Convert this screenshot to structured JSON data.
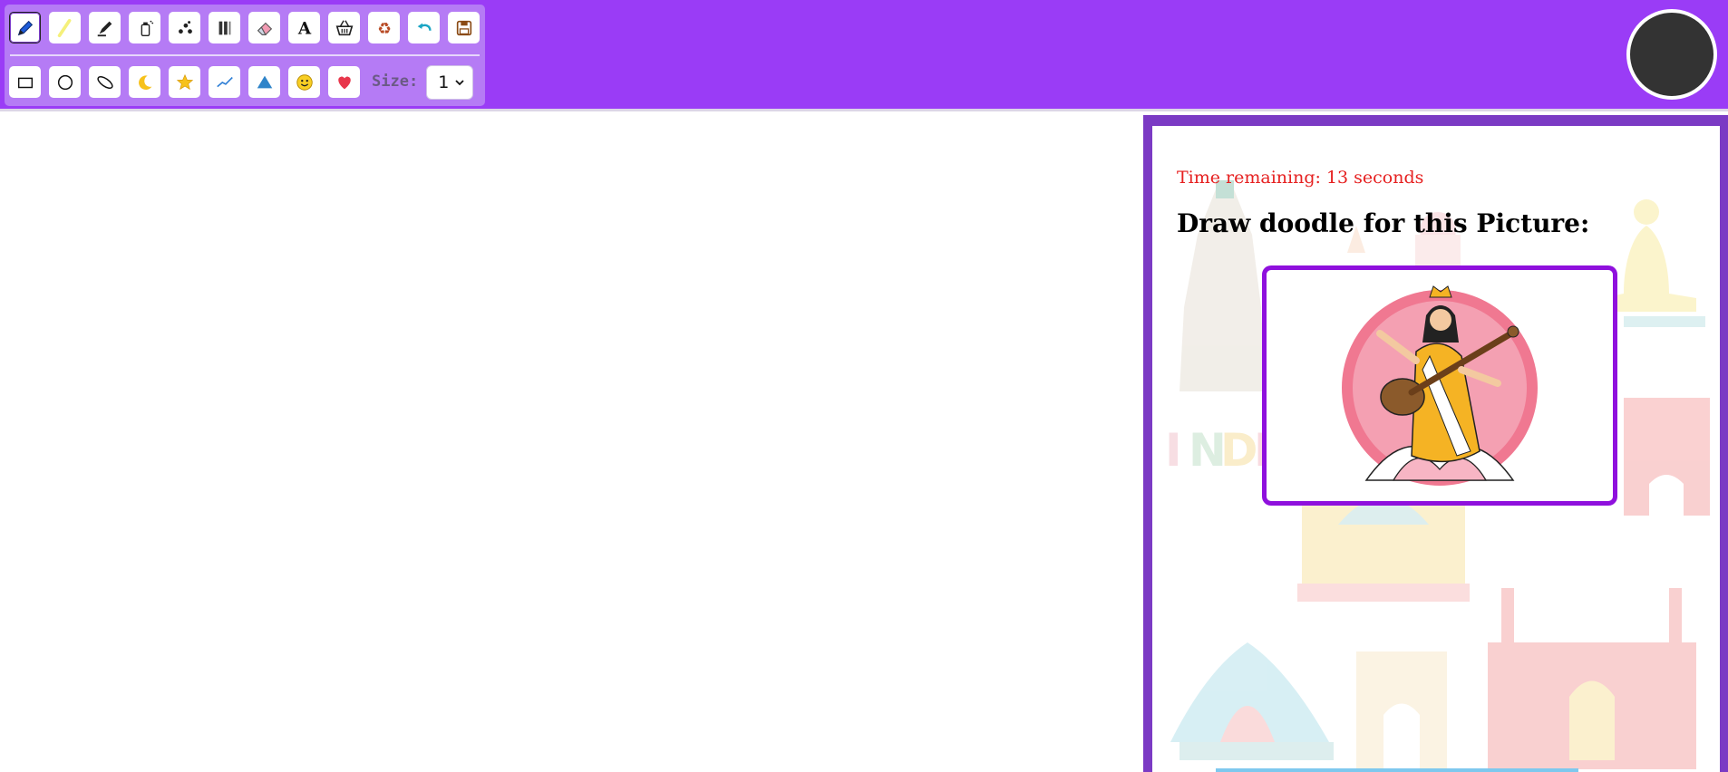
{
  "toolbar": {
    "row1_tools": [
      {
        "name": "pen-tool-button",
        "icon": "pen-icon"
      },
      {
        "name": "highlighter-tool-button",
        "icon": "highlighter-icon"
      },
      {
        "name": "marker-tool-button",
        "icon": "marker-icon"
      },
      {
        "name": "spray-tool-button",
        "icon": "spray-can-icon"
      },
      {
        "name": "dots-tool-button",
        "icon": "dots-icon"
      },
      {
        "name": "pattern-brush-button",
        "icon": "pattern-brush-icon"
      },
      {
        "name": "eraser-tool-button",
        "icon": "eraser-icon"
      },
      {
        "name": "text-tool-button",
        "icon": "text-a-icon"
      },
      {
        "name": "fill-bucket-button",
        "icon": "basket-icon"
      },
      {
        "name": "clear-recycle-button",
        "icon": "recycle-icon"
      },
      {
        "name": "undo-button",
        "icon": "undo-arrow-icon"
      },
      {
        "name": "save-button",
        "icon": "floppy-disk-icon"
      }
    ],
    "row2_tools": [
      {
        "name": "rectangle-shape-button",
        "icon": "rectangle-icon"
      },
      {
        "name": "circle-shape-button",
        "icon": "circle-icon"
      },
      {
        "name": "ellipse-shape-button",
        "icon": "ellipse-icon"
      },
      {
        "name": "moon-shape-button",
        "icon": "crescent-moon-icon"
      },
      {
        "name": "star-shape-button",
        "icon": "star-icon"
      },
      {
        "name": "line-shape-button",
        "icon": "line-icon"
      },
      {
        "name": "triangle-shape-button",
        "icon": "triangle-icon"
      },
      {
        "name": "smiley-shape-button",
        "icon": "smiley-icon"
      },
      {
        "name": "heart-shape-button",
        "icon": "heart-icon"
      }
    ],
    "size_label": "Size:",
    "size_value": "1",
    "active_tool": "pen-tool-button"
  },
  "colors": {
    "header": "#9a3cf6",
    "toolbox": "#b57bf5",
    "panel_border": "#7b3ac4",
    "frame": "#8f10dd",
    "timer": "#e62020",
    "avatar": "#333333"
  },
  "panel": {
    "timer_text": "Time remaining: 13 seconds",
    "title": "Draw doodle for this Picture:",
    "background_word": "INDIA",
    "picture_subject": "saraswati-veena-illustration"
  }
}
